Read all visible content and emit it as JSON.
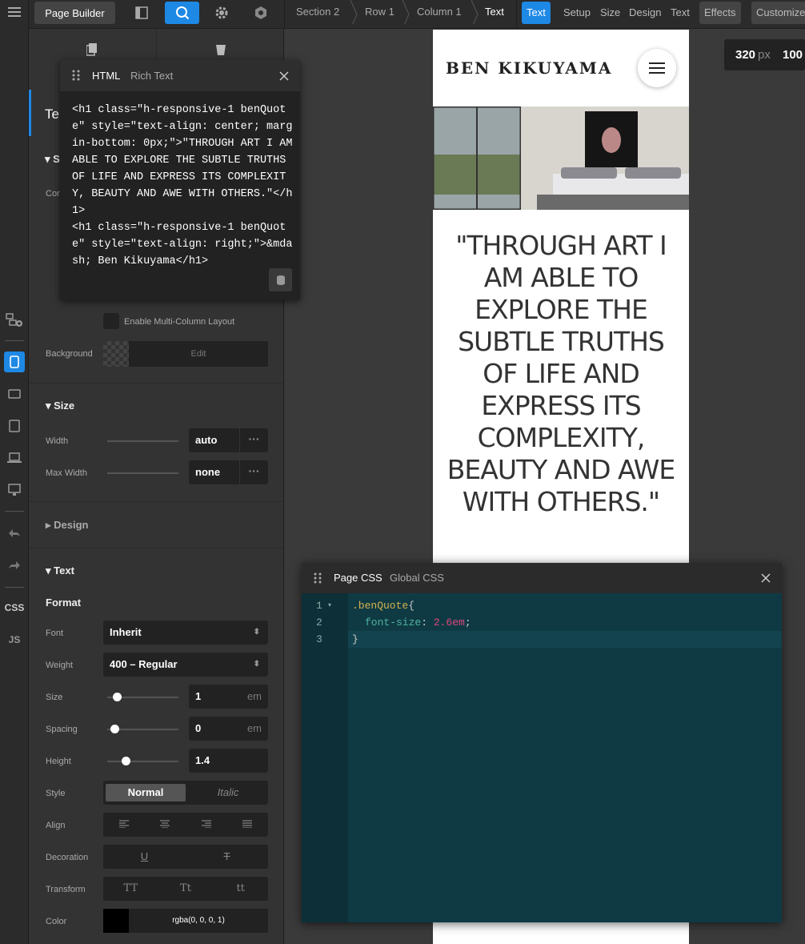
{
  "topbar": {
    "app_button": "Page Builder",
    "breadcrumbs": [
      "Section 2",
      "Row 1",
      "Column 1",
      "Text"
    ],
    "tabs": [
      "Text",
      "Setup",
      "Size",
      "Design",
      "Text",
      "Effects",
      "Customize"
    ]
  },
  "leftbar": {
    "css_label": "CSS",
    "js_label": "JS"
  },
  "panel": {
    "title_partial": "Te",
    "s_partial": "S",
    "com_partial": "Com",
    "multicolumn_label": "Enable Multi-Column Layout",
    "background_label": "Background",
    "background_edit": "Edit",
    "size_section": "Size",
    "width_label": "Width",
    "width_value": "auto",
    "maxwidth_label": "Max Width",
    "maxwidth_value": "none",
    "design_section": "Design",
    "text_section": "Text",
    "format_heading": "Format",
    "font_label": "Font",
    "font_value": "Inherit",
    "weight_label": "Weight",
    "weight_value": "400 – Regular",
    "size_label": "Size",
    "size_value": "1",
    "size_unit": "em",
    "spacing_label": "Spacing",
    "spacing_value": "0",
    "spacing_unit": "em",
    "height_label": "Height",
    "height_value": "1.4",
    "style_label": "Style",
    "style_normal": "Normal",
    "style_italic": "Italic",
    "align_label": "Align",
    "decoration_label": "Decoration",
    "transform_label": "Transform",
    "transform_options": [
      "TT",
      "Tt",
      "tt"
    ],
    "color_label": "Color",
    "color_value": "rgba(0, 0, 0, 1)"
  },
  "html_editor": {
    "tab_html": "HTML",
    "tab_rich": "Rich Text",
    "code": "<h1 class=\"h-responsive-1 benQuote\" style=\"text-align: center; margin-bottom: 0px;\">\"THROUGH ART I AM ABLE TO EXPLORE THE SUBTLE TRUTHS OF LIFE AND EXPRESS ITS COMPLEXITY, BEAUTY AND AWE WITH OTHERS.\"</h1>\n<h1 class=\"h-responsive-1 benQuote\" style=\"text-align: right;\">&mdash; Ben Kikuyama</h1>"
  },
  "preview": {
    "logo": "BEN KIKUYAMA",
    "quote": "\"THROUGH ART I AM ABLE TO EXPLORE THE SUBTLE TRUTHS OF LIFE AND EXPRESS ITS COMPLEXITY, BEAUTY AND AWE WITH OTHERS.\""
  },
  "viewport": {
    "width": "320",
    "unit": "px",
    "zoom": "100"
  },
  "css_editor": {
    "tab_page": "Page CSS",
    "tab_global": "Global CSS",
    "line_numbers": [
      "1",
      "2",
      "3"
    ],
    "line1_selector": ".benQuote",
    "line1_brace": "{",
    "line2_prop": "font-size",
    "line2_colon": ": ",
    "line2_value": "2.6em",
    "line2_semi": ";",
    "line3": "}"
  },
  "colors": {
    "accent": "#1e88e5",
    "panel_bg": "#333333",
    "css_bg": "#0f3a44",
    "css_selector": "#d4b24c",
    "css_value": "#e0457b"
  }
}
